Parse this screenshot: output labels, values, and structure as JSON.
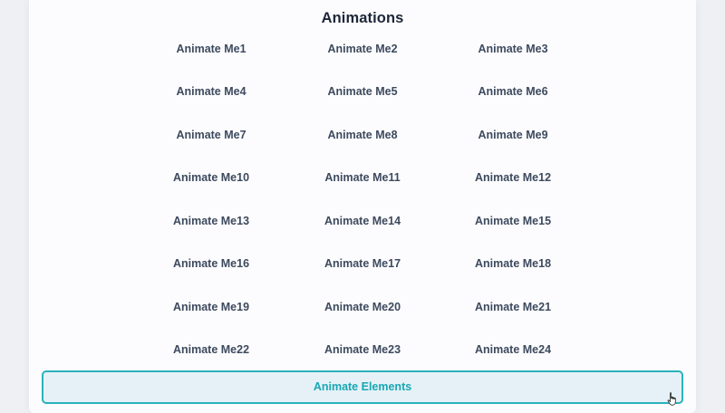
{
  "title": "Animations",
  "items": [
    "Animate Me1",
    "Animate Me2",
    "Animate Me3",
    "Animate Me4",
    "Animate Me5",
    "Animate Me6",
    "Animate Me7",
    "Animate Me8",
    "Animate Me9",
    "Animate Me10",
    "Animate Me11",
    "Animate Me12",
    "Animate Me13",
    "Animate Me14",
    "Animate Me15",
    "Animate Me16",
    "Animate Me17",
    "Animate Me18",
    "Animate Me19",
    "Animate Me20",
    "Animate Me21",
    "Animate Me22",
    "Animate Me23",
    "Animate Me24"
  ],
  "button_label": "Animate Elements",
  "colors": {
    "accent": "#2ab2bb",
    "button_bg": "#e5f1f6",
    "text": "#3d4a5e",
    "title": "#1d2738"
  },
  "icons": {
    "cursor": "pointer-hand-cursor-icon"
  }
}
